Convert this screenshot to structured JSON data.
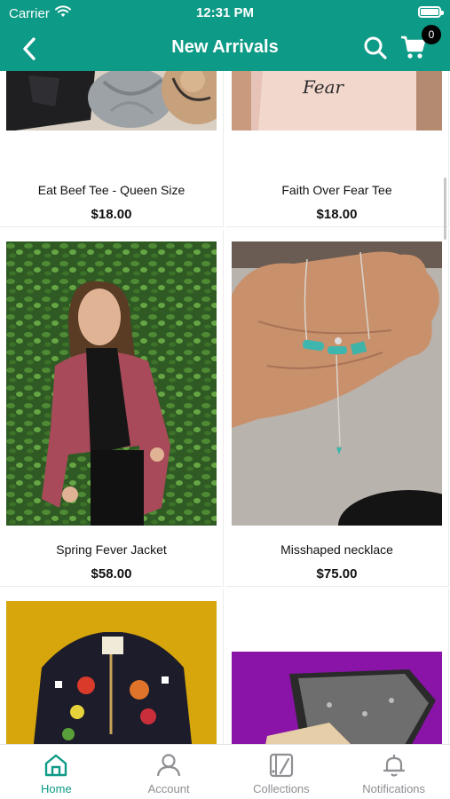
{
  "status": {
    "carrier": "Carrier",
    "time": "12:31 PM"
  },
  "nav": {
    "title": "New Arrivals",
    "cart_count": "0"
  },
  "products": [
    {
      "name": "Eat Beef Tee - Queen Size",
      "price": "$18.00"
    },
    {
      "name": "Faith Over Fear Tee",
      "price": "$18.00"
    },
    {
      "name": "Spring Fever Jacket",
      "price": "$58.00"
    },
    {
      "name": "Misshaped necklace",
      "price": "$75.00"
    },
    {
      "name": "",
      "price": ""
    },
    {
      "name": "",
      "price": ""
    }
  ],
  "image_text": {
    "faith_tee_print": "Fear"
  },
  "tabs": [
    {
      "label": "Home",
      "icon": "home-icon",
      "active": true
    },
    {
      "label": "Account",
      "icon": "account-icon",
      "active": false
    },
    {
      "label": "Collections",
      "icon": "collections-icon",
      "active": false
    },
    {
      "label": "Notifications",
      "icon": "bell-icon",
      "active": false
    }
  ],
  "colors": {
    "brand": "#0d9a86",
    "tab_inactive": "#8e8e93"
  }
}
